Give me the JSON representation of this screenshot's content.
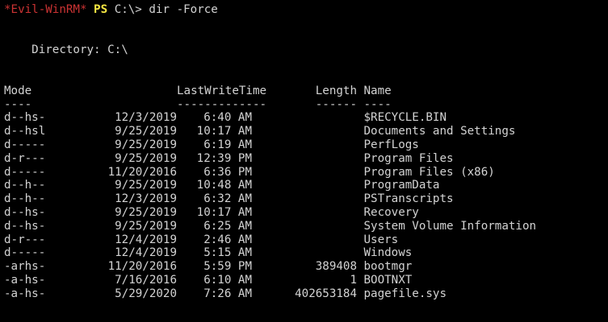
{
  "prompt": {
    "user": "*Evil-WinRM*",
    "shell": "PS",
    "path": "C:\\>",
    "command": "dir -Force"
  },
  "directory_line": "    Directory: C:\\",
  "headers": {
    "mode": "Mode",
    "last_write_time": "LastWriteTime",
    "length": "Length",
    "name": "Name"
  },
  "underlines": {
    "mode": "----",
    "last_write_time": "-------------",
    "length": "------",
    "name": "----"
  },
  "rows": [
    {
      "mode": "d--hs-",
      "date": "12/3/2019",
      "time": "6:40 AM",
      "length": "",
      "name": "$RECYCLE.BIN"
    },
    {
      "mode": "d--hsl",
      "date": "9/25/2019",
      "time": "10:17 AM",
      "length": "",
      "name": "Documents and Settings"
    },
    {
      "mode": "d-----",
      "date": "9/25/2019",
      "time": "6:19 AM",
      "length": "",
      "name": "PerfLogs"
    },
    {
      "mode": "d-r---",
      "date": "9/25/2019",
      "time": "12:39 PM",
      "length": "",
      "name": "Program Files"
    },
    {
      "mode": "d-----",
      "date": "11/20/2016",
      "time": "6:36 PM",
      "length": "",
      "name": "Program Files (x86)"
    },
    {
      "mode": "d--h--",
      "date": "9/25/2019",
      "time": "10:48 AM",
      "length": "",
      "name": "ProgramData"
    },
    {
      "mode": "d--h--",
      "date": "12/3/2019",
      "time": "6:32 AM",
      "length": "",
      "name": "PSTranscripts"
    },
    {
      "mode": "d--hs-",
      "date": "9/25/2019",
      "time": "10:17 AM",
      "length": "",
      "name": "Recovery"
    },
    {
      "mode": "d--hs-",
      "date": "9/25/2019",
      "time": "6:25 AM",
      "length": "",
      "name": "System Volume Information"
    },
    {
      "mode": "d-r---",
      "date": "12/4/2019",
      "time": "2:46 AM",
      "length": "",
      "name": "Users"
    },
    {
      "mode": "d-----",
      "date": "12/4/2019",
      "time": "5:15 AM",
      "length": "",
      "name": "Windows"
    },
    {
      "mode": "-arhs-",
      "date": "11/20/2016",
      "time": "5:59 PM",
      "length": "389408",
      "name": "bootmgr"
    },
    {
      "mode": "-a-hs-",
      "date": "7/16/2016",
      "time": "6:10 AM",
      "length": "1",
      "name": "BOOTNXT"
    },
    {
      "mode": "-a-hs-",
      "date": "5/29/2020",
      "time": "7:26 AM",
      "length": "402653184",
      "name": "pagefile.sys"
    }
  ],
  "colors": {
    "background": "#000000",
    "text": "#d3d3d3",
    "prompt_user": "#cc3333",
    "prompt_ps": "#f5e642"
  }
}
